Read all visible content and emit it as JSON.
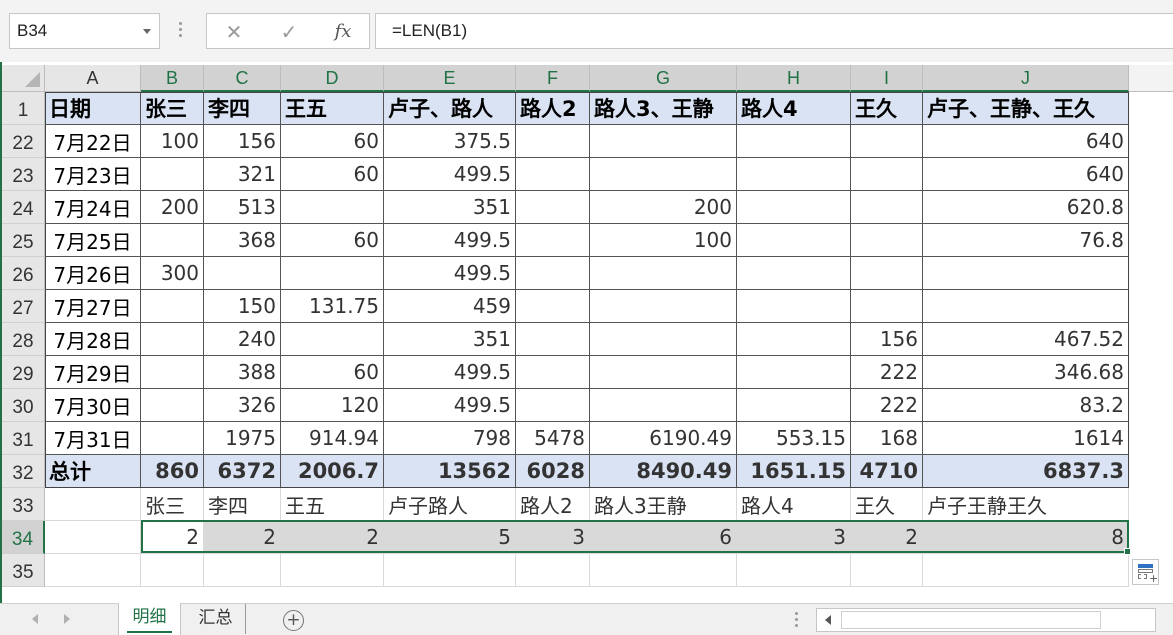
{
  "formula_bar": {
    "name_box": "B34",
    "cancel_icon": "✕",
    "enter_icon": "✓",
    "fx_label": "fx",
    "formula": "=LEN(B1)"
  },
  "columns": [
    "A",
    "B",
    "C",
    "D",
    "E",
    "F",
    "G",
    "H",
    "I",
    "J"
  ],
  "rows": [
    {
      "num": "1",
      "cells": [
        "日期",
        "张三",
        "李四",
        "王五",
        "卢子、路人",
        "路人2",
        "路人3、王静",
        "路人4",
        "王久",
        "卢子、王静、王久"
      ]
    },
    {
      "num": "22",
      "cells": [
        "7月22日",
        "100",
        "156",
        "60",
        "375.5",
        "",
        "",
        "",
        "",
        "640"
      ]
    },
    {
      "num": "23",
      "cells": [
        "7月23日",
        "",
        "321",
        "60",
        "499.5",
        "",
        "",
        "",
        "",
        "640"
      ]
    },
    {
      "num": "24",
      "cells": [
        "7月24日",
        "200",
        "513",
        "",
        "351",
        "",
        "200",
        "",
        "",
        "620.8"
      ]
    },
    {
      "num": "25",
      "cells": [
        "7月25日",
        "",
        "368",
        "60",
        "499.5",
        "",
        "100",
        "",
        "",
        "76.8"
      ]
    },
    {
      "num": "26",
      "cells": [
        "7月26日",
        "300",
        "",
        "",
        "499.5",
        "",
        "",
        "",
        "",
        ""
      ]
    },
    {
      "num": "27",
      "cells": [
        "7月27日",
        "",
        "150",
        "131.75",
        "459",
        "",
        "",
        "",
        "",
        ""
      ]
    },
    {
      "num": "28",
      "cells": [
        "7月28日",
        "",
        "240",
        "",
        "351",
        "",
        "",
        "",
        "156",
        "467.52"
      ]
    },
    {
      "num": "29",
      "cells": [
        "7月29日",
        "",
        "388",
        "60",
        "499.5",
        "",
        "",
        "",
        "222",
        "346.68"
      ]
    },
    {
      "num": "30",
      "cells": [
        "7月30日",
        "",
        "326",
        "120",
        "499.5",
        "",
        "",
        "",
        "222",
        "83.2"
      ]
    },
    {
      "num": "31",
      "cells": [
        "7月31日",
        "",
        "1975",
        "914.94",
        "798",
        "5478",
        "6190.49",
        "553.15",
        "168",
        "1614"
      ]
    },
    {
      "num": "32",
      "cells": [
        "总计",
        "860",
        "6372",
        "2006.7",
        "13562",
        "6028",
        "8490.49",
        "1651.15",
        "4710",
        "6837.3"
      ]
    },
    {
      "num": "33",
      "cells": [
        "",
        "张三",
        "李四",
        "王五",
        "卢子路人",
        "路人2",
        "路人3王静",
        "路人4",
        "王久",
        "卢子王静王久"
      ]
    },
    {
      "num": "34",
      "cells": [
        "",
        "2",
        "2",
        "2",
        "5",
        "3",
        "6",
        "3",
        "2",
        "8"
      ]
    },
    {
      "num": "35",
      "cells": [
        "",
        "",
        "",
        "",
        "",
        "",
        "",
        "",
        "",
        ""
      ]
    }
  ],
  "sheet_tabs": [
    "明细",
    "汇总"
  ],
  "add_sheet_icon": "+",
  "colors": {
    "header_fill": "#dae3f3",
    "selection": "#217346",
    "selected_fill": "#d9d9d9"
  }
}
